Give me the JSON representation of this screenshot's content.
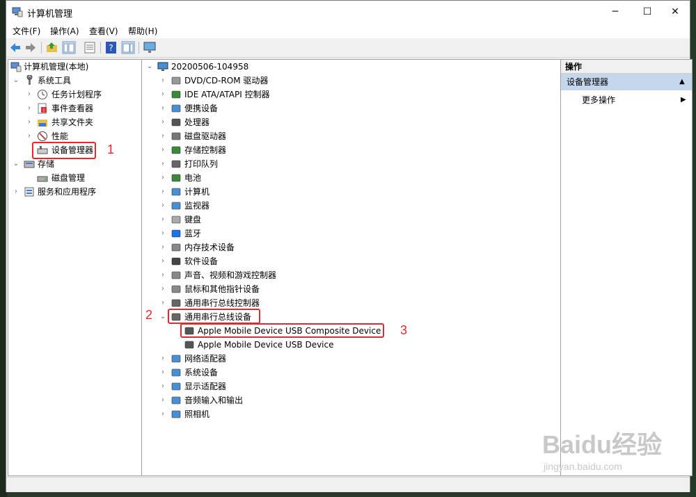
{
  "window": {
    "title": "计算机管理"
  },
  "menu": [
    "文件(F)",
    "操作(A)",
    "查看(V)",
    "帮助(H)"
  ],
  "toolbar_icons": [
    "back-icon",
    "forward-icon",
    "up-folder-icon",
    "show-hide-tree-icon",
    "properties-icon",
    "help-icon",
    "show-action-pane-icon",
    "monitor-icon"
  ],
  "left_tree": {
    "root": "计算机管理(本地)",
    "system_tools": "系统工具",
    "task_scheduler": "任务计划程序",
    "event_viewer": "事件查看器",
    "shared_folders": "共享文件夹",
    "performance": "性能",
    "device_manager": "设备管理器",
    "storage": "存储",
    "disk_management": "磁盘管理",
    "services_apps": "服务和应用程序"
  },
  "device_tree": {
    "root": "20200506-104958",
    "categories": [
      "DVD/CD-ROM 驱动器",
      "IDE ATA/ATAPI 控制器",
      "便携设备",
      "处理器",
      "磁盘驱动器",
      "存储控制器",
      "打印队列",
      "电池",
      "计算机",
      "监视器",
      "键盘",
      "蓝牙",
      "内存技术设备",
      "软件设备",
      "声音、视频和游戏控制器",
      "鼠标和其他指针设备",
      "通用串行总线控制器",
      "通用串行总线设备"
    ],
    "usb_children": [
      "Apple Mobile Device USB Composite Device",
      "Apple Mobile Device USB Device"
    ],
    "categories_after": [
      "网络适配器",
      "系统设备",
      "显示适配器",
      "音频输入和输出",
      "照相机"
    ]
  },
  "actions": {
    "header": "操作",
    "section": "设备管理器",
    "more": "更多操作"
  },
  "annotations": [
    "1",
    "2",
    "3"
  ],
  "watermark": {
    "brand": "Baidu经验",
    "url": "jingyan.baidu.com"
  },
  "colors": {
    "highlight_red": "#e8262e",
    "action_selected": "#c5d7ec"
  }
}
